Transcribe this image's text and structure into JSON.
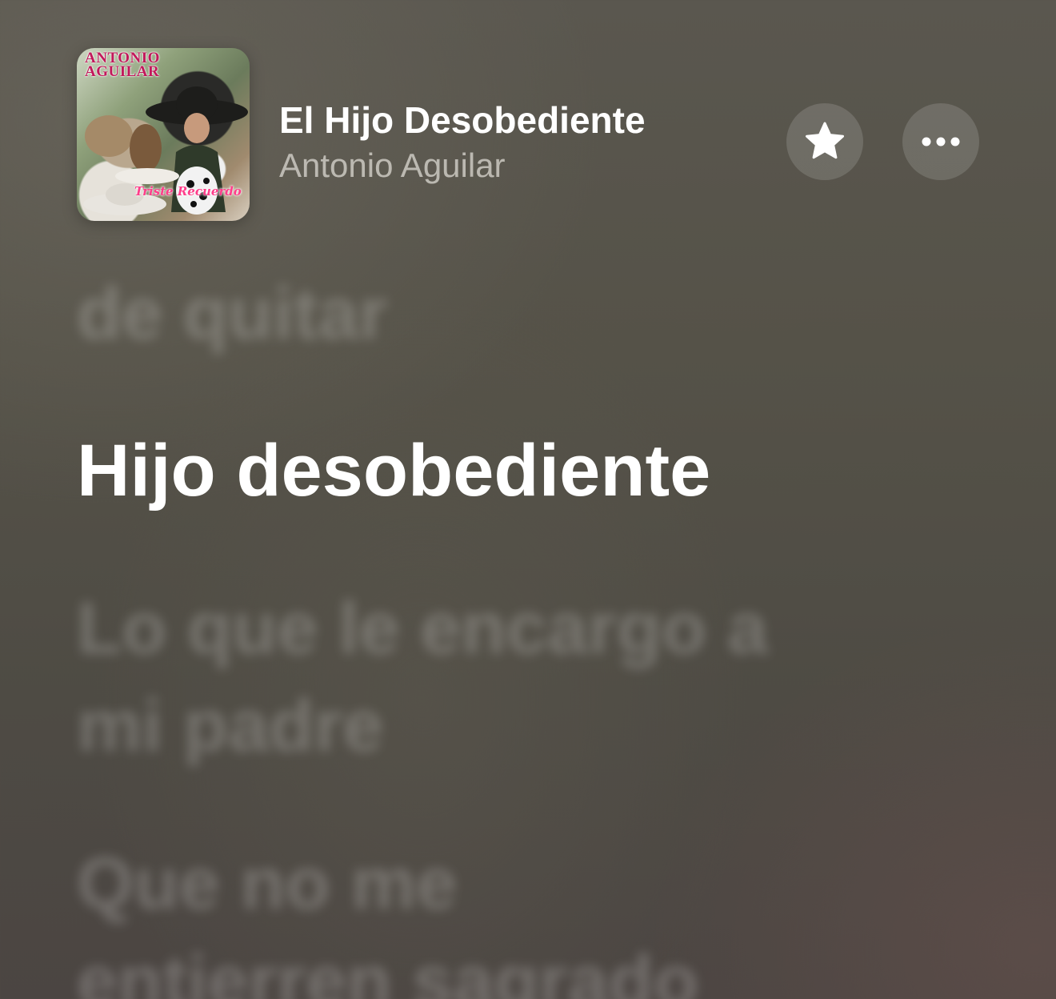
{
  "now_playing": {
    "title": "El Hijo Desobediente",
    "artist": "Antonio Aguilar",
    "artwork": {
      "brand_line1": "ANTONIO",
      "brand_line2": "AGUILAR",
      "tagline": "Triste Recuerdo"
    },
    "favorite_icon": "star-icon",
    "more_icon": "ellipsis-icon"
  },
  "lyrics": {
    "previous_line": "de quitar",
    "current_line": "Hijo desobediente",
    "next_line_1": "Lo que le encargo a",
    "next_line_2": "mi padre",
    "next_line_3": "Que no me",
    "next_line_4": "entierren sagrado"
  },
  "colors": {
    "background": "#524f48",
    "active_lyric": "#ffffff",
    "inactive_lyric": "rgba(255,255,255,0.22)",
    "secondary_text": "#b9b6ae",
    "artwork_brand": "#c2185b",
    "artwork_tagline": "#ff3d8a"
  }
}
